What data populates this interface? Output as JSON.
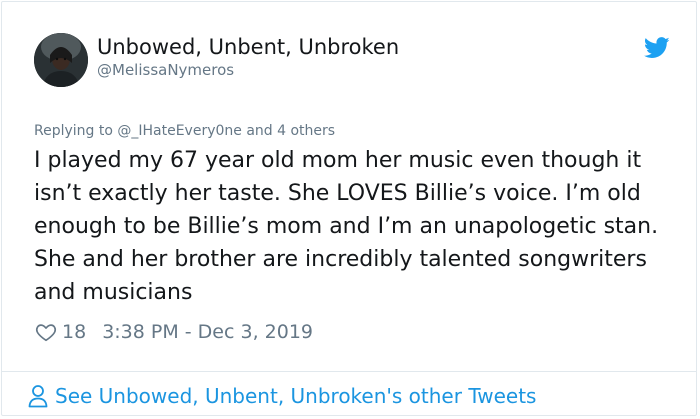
{
  "author": {
    "display_name": "Unbowed, Unbent, Unbroken",
    "handle": "@MelissaNymeros",
    "avatar_icon": "profile-photo"
  },
  "header": {
    "platform_icon": "twitter-bird-icon",
    "platform_color": "#1da1f2"
  },
  "tweet": {
    "replying_to": "Replying to @_IHateEvery0ne and 4 others",
    "text": "I played my 67 year old mom her music even though it isn’t exactly her taste. She LOVES Billie’s voice. I’m old enough to be Billie’s mom and I’m an unapologetic stan. She and her brother are incredibly talented songwriters and musicians",
    "like_count": "18",
    "timestamp": "3:38 PM - Dec 3, 2019"
  },
  "footer": {
    "link_text": "See Unbowed, Unbent, Unbroken's other Tweets",
    "link_icon": "person-icon",
    "link_color": "#1b95e0"
  }
}
